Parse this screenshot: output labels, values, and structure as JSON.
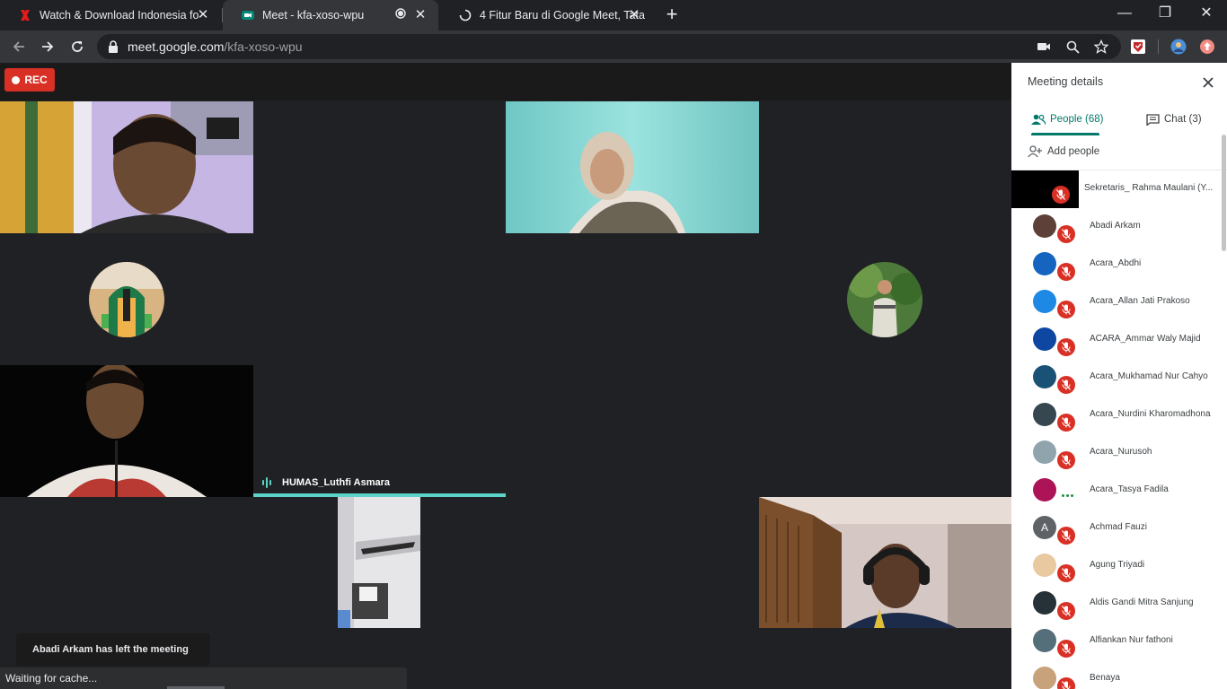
{
  "browser": {
    "tabs": [
      {
        "title": "Watch & Download Indonesia fo",
        "icon": "red-x-favicon-icon",
        "active": false
      },
      {
        "title": "Meet - kfa-xoso-wpu",
        "icon": "meet-favicon-icon",
        "active": true
      },
      {
        "title": "4 Fitur Baru di Google Meet, Tata",
        "icon": "loading-spinner-icon",
        "active": false
      }
    ],
    "url_host": "meet.google.com",
    "url_path": "/kfa-xoso-wpu"
  },
  "meet": {
    "rec_label": "REC",
    "speaker_name": "HUMAS_Luthfi Asmara",
    "toast": "Abadi Arkam has left the meeting"
  },
  "status_bar": "Waiting for cache...",
  "panel": {
    "title": "Meeting details",
    "people_tab": "People (68)",
    "chat_tab": "Chat (3)",
    "add_people": "Add people",
    "participants": [
      {
        "name": "Sekretaris_ Rahma Maulani (Y...",
        "avatar_color": "#000000",
        "muted": true
      },
      {
        "name": "Abadi Arkam",
        "avatar_color": "#5d4037",
        "muted": true
      },
      {
        "name": "Acara_Abdhi",
        "avatar_color": "#1565c0",
        "muted": true
      },
      {
        "name": "Acara_Allan Jati Prakoso",
        "avatar_color": "#1e88e5",
        "muted": true
      },
      {
        "name": "ACARA_Ammar Waly Majid",
        "avatar_color": "#0d47a1",
        "muted": true
      },
      {
        "name": "Acara_Mukhamad Nur Cahyo",
        "avatar_color": "#1a5276",
        "muted": true
      },
      {
        "name": "Acara_Nurdini Kharomadhona",
        "avatar_color": "#37474f",
        "muted": true
      },
      {
        "name": "Acara_Nurusoh",
        "avatar_color": "#90a4ae",
        "muted": true
      },
      {
        "name": "Acara_Tasya Fadila",
        "avatar_color": "#ad1457",
        "muted": false
      },
      {
        "name": "Achmad Fauzi",
        "avatar_color": "#5f6368",
        "initial": "A",
        "muted": true
      },
      {
        "name": "Agung Triyadi",
        "avatar_color": "#e8c9a0",
        "muted": true
      },
      {
        "name": "Aldis Gandi Mitra Sanjung",
        "avatar_color": "#263238",
        "muted": true
      },
      {
        "name": "Alfiankan Nur fathoni",
        "avatar_color": "#546e7a",
        "muted": true
      },
      {
        "name": "Benaya",
        "avatar_color": "#c8a27a",
        "muted": true
      }
    ]
  },
  "colors": {
    "meet_bg": "#202124",
    "speaking_accent": "#5bd4c7",
    "rec_red": "#d93025",
    "panel_accent": "#00796b"
  }
}
